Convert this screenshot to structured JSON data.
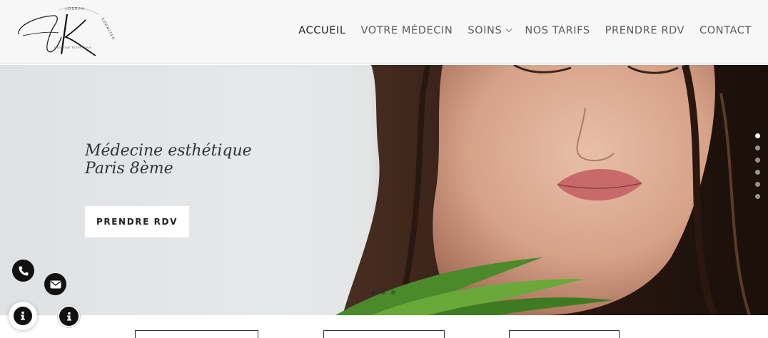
{
  "logo": {
    "letters": "JK",
    "arc_text_top": "JOSEPH",
    "arc_text_right": "KORNITER",
    "subtitle": "MÉDECINE ESTHÉTIQUE"
  },
  "nav": {
    "items": [
      {
        "label": "ACCUEIL",
        "active": true
      },
      {
        "label": "VOTRE MÉDECIN"
      },
      {
        "label": "SOINS",
        "has_dropdown": true
      },
      {
        "label": "NOS TARIFS"
      },
      {
        "label": "PRENDRE RDV"
      },
      {
        "label": "CONTACT"
      }
    ]
  },
  "hero": {
    "title_line1": "Médecine esthétique",
    "title_line2": "Paris 8ème",
    "cta_label": "PRENDRE RDV",
    "side_dots": 6,
    "active_side_dot": 0,
    "bottom_dots": 3,
    "active_bottom_dot": 0
  },
  "floating": {
    "phone_icon": "phone-icon",
    "mail_icon": "envelope-icon",
    "info_icon": "info-icon"
  },
  "colors": {
    "header_bg": "#f7f7f7",
    "nav_text": "#5a5a5a",
    "nav_active": "#1f1f1f",
    "cta_bg": "#ffffff",
    "fab_bg": "#111111"
  }
}
